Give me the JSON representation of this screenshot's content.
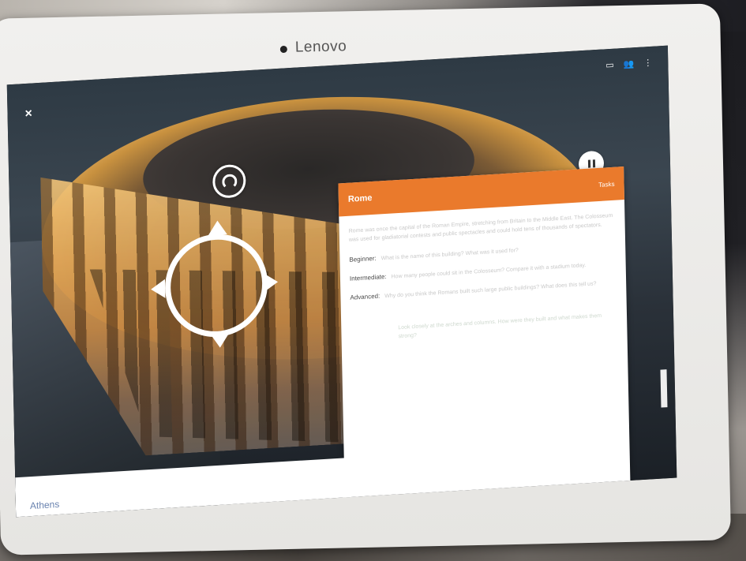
{
  "device": {
    "brand": "Lenovo"
  },
  "app": {
    "close_icon": "×",
    "status_icons": [
      "cast-icon",
      "people-icon",
      "more-icon"
    ],
    "card": {
      "title": "Rome",
      "action": "Tasks",
      "paragraph": "Rome was once the capital of the Roman Empire, stretching from Britain to the Middle East. The Colosseum was used for gladiatorial contests and public spectacles and could hold tens of thousands of spectators.",
      "levels": [
        {
          "label": "Beginner:",
          "text": "What is the name of this building? What was it used for?"
        },
        {
          "label": "Intermediate:",
          "text": "How many people could sit in the Colosseum? Compare it with a stadium today."
        },
        {
          "label": "Advanced:",
          "text": "Why do you think the Romans built such large public buildings? What does this tell us?"
        }
      ],
      "note": "Look closely at the arches and columns. How were they built and what makes them strong?"
    },
    "bottom_location": "Athens"
  },
  "colors": {
    "accent": "#ea7a2c",
    "link": "#6b84b0"
  }
}
